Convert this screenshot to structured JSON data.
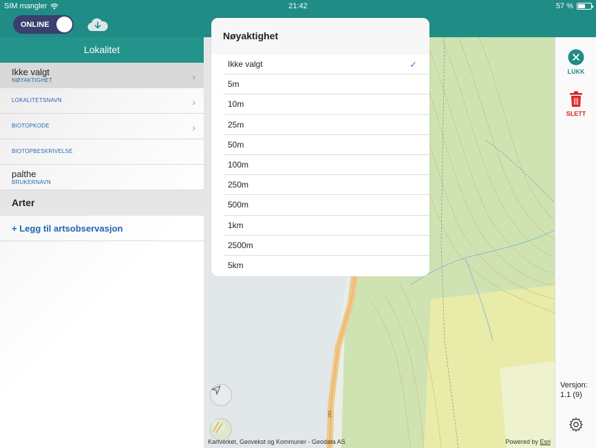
{
  "statusbar": {
    "carrier": "SIM mangler",
    "time": "21:42",
    "battery_text": "57 %",
    "battery_level": 0.57
  },
  "header": {
    "toggle_label": "ONLINE",
    "cloud_icon": "cloud-download-icon"
  },
  "sidebar": {
    "title": "Lokalitet",
    "rows": [
      {
        "value": "Ikke valgt",
        "label": "NØYAKTIGHET"
      },
      {
        "label": "LOKALITETSNAVN"
      },
      {
        "label": "BIOTOPKODE"
      },
      {
        "label": "BIOTOPBESKRIVELSE"
      },
      {
        "value": "palthe",
        "label": "BRUKERNAVN"
      }
    ],
    "section": "Arter",
    "add_label": "+ Legg til artsobservasjon"
  },
  "popover": {
    "title": "Nøyaktighet",
    "options": [
      "Ikke valgt",
      "5m",
      "10m",
      "25m",
      "50m",
      "100m",
      "250m",
      "500m",
      "1km",
      "2500m",
      "5km"
    ],
    "selected": "Ikke valgt"
  },
  "map": {
    "attribution": "Kartverket, Geovekst og Kommuner - Geodata AS",
    "powered_by": "Powered by",
    "esri": "Esri",
    "road_label": "283"
  },
  "rail": {
    "close_label": "LUKK",
    "delete_label": "SLETT",
    "version_label": "Versjon:",
    "version_value": "1.1 (9)"
  },
  "colors": {
    "accent": "#1f8c86",
    "link": "#2065b0",
    "delete": "#e02020",
    "check": "#2a7de1"
  }
}
